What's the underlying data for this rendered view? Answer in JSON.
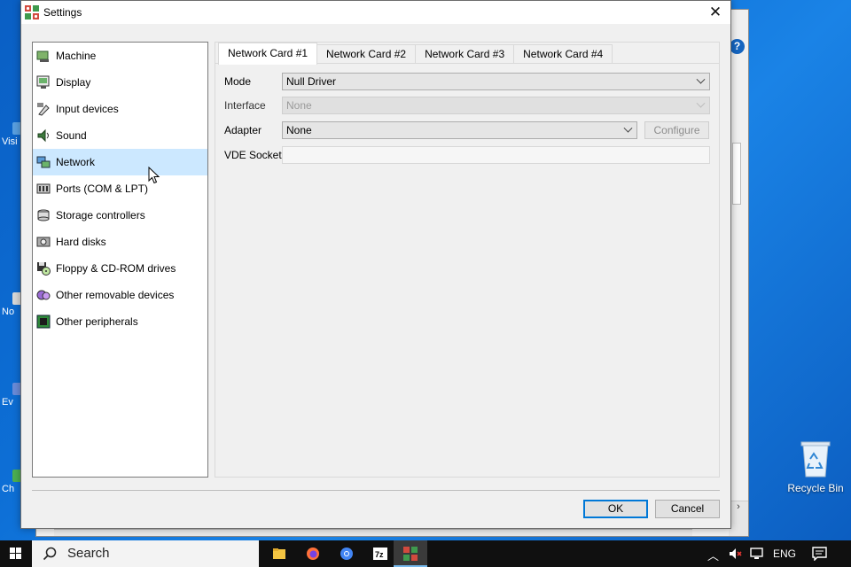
{
  "dialog": {
    "title": "Settings",
    "close_label": "✕"
  },
  "sidebar": {
    "items": [
      {
        "label": "Machine",
        "icon": "machine-icon"
      },
      {
        "label": "Display",
        "icon": "display-icon"
      },
      {
        "label": "Input devices",
        "icon": "input-devices-icon"
      },
      {
        "label": "Sound",
        "icon": "sound-icon"
      },
      {
        "label": "Network",
        "icon": "network-icon",
        "selected": true
      },
      {
        "label": "Ports (COM & LPT)",
        "icon": "ports-icon"
      },
      {
        "label": "Storage controllers",
        "icon": "storage-icon"
      },
      {
        "label": "Hard disks",
        "icon": "hard-disk-icon"
      },
      {
        "label": "Floppy & CD-ROM drives",
        "icon": "floppy-cdrom-icon"
      },
      {
        "label": "Other removable devices",
        "icon": "removable-icon"
      },
      {
        "label": "Other peripherals",
        "icon": "peripherals-icon"
      }
    ]
  },
  "tabs": [
    {
      "label": "Network Card #1",
      "active": true
    },
    {
      "label": "Network Card #2"
    },
    {
      "label": "Network Card #3"
    },
    {
      "label": "Network Card #4"
    }
  ],
  "network_card": {
    "mode_label": "Mode",
    "mode_value": "Null Driver",
    "interface_label": "Interface",
    "interface_value": "None",
    "adapter_label": "Adapter",
    "adapter_value": "None",
    "configure_label": "Configure",
    "vde_socket_label": "VDE Socket",
    "vde_socket_value": ""
  },
  "footer": {
    "ok_label": "OK",
    "cancel_label": "Cancel"
  },
  "desktop": {
    "recycle_bin_label": "Recycle Bin",
    "fragments": [
      "Visi",
      "No",
      "Ev",
      "Ch"
    ]
  },
  "taskbar": {
    "search_label": "Search",
    "language": "ENG",
    "apps": [
      "file-explorer-icon",
      "firefox-icon",
      "chrome-icon",
      "7zip-icon",
      "86box-icon"
    ]
  },
  "colors": {
    "accent": "#0078d7",
    "selection": "#cce8ff",
    "desktop": "#0d6fd6"
  }
}
